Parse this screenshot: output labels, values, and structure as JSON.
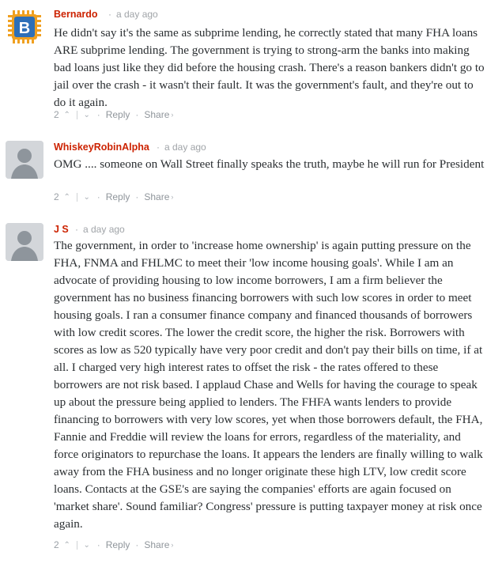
{
  "comments": [
    {
      "author": "Bernardo",
      "time": "a day ago",
      "avatar_letter": "B",
      "text": "He didn't say it's the same as subprime lending, he correctly stated that many FHA loans ARE subprime lending. The government is trying to strong-arm the banks into making bad loans just like they did before the housing crash. There's a reason bankers didn't go to jail over the crash - it wasn't their fault. It was the government's fault, and they're out to do it again.",
      "upvotes": "2",
      "reply_label": "Reply",
      "share_label": "Share"
    },
    {
      "author": "WhiskeyRobinAlpha",
      "time": "a day ago",
      "text": "OMG .... someone on Wall Street finally speaks the truth, maybe he will run for President",
      "upvotes": "2",
      "reply_label": "Reply",
      "share_label": "Share"
    },
    {
      "author": "J S",
      "time": "a day ago",
      "text": "The government, in order to 'increase home ownership' is again putting pressure on the FHA, FNMA and FHLMC to meet their 'low income housing goals'. While I am an advocate of providing housing to low income borrowers, I am a firm believer the government has no business financing borrowers with such low scores in order to meet housing goals. I ran a consumer finance company and financed thousands of borrowers with low credit scores. The lower the credit score, the higher the risk. Borrowers with scores as low as 520 typically have very poor credit and don't pay their bills on time, if at all. I charged very high interest rates to offset the risk - the rates offered to these borrowers are not risk based. I applaud Chase and Wells for having the courage to speak up about the pressure being applied to lenders. The FHFA wants lenders to provide financing to borrowers with very low scores, yet when those borrowers default, the FHA, Fannie and Freddie will review the loans for errors, regardless of the materiality, and force originators to repurchase the loans. It appears the lenders are finally willing to walk away from the FHA business and no longer originate these high LTV, low credit score loans. Contacts at the GSE's are saying the companies' efforts are again focused on 'market share'. Sound familiar? Congress' pressure is putting taxpayer money at risk once again.",
      "upvotes": "2",
      "reply_label": "Reply",
      "share_label": "Share"
    }
  ],
  "colors": {
    "author": "#cc2200",
    "avatar_bg": "#2d6fb8",
    "avatar_chip": "#f0a020"
  },
  "icons": {
    "upvote": "chevron-up-icon",
    "downvote": "chevron-down-icon",
    "share": "chevron-right-icon"
  }
}
